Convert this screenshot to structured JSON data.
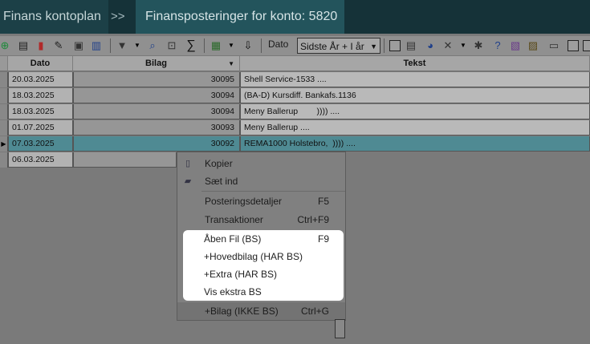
{
  "tabs": {
    "first": "Finans kontoplan",
    "separator": ">>",
    "active": "Finansposteringer for konto: 5820"
  },
  "toolbar": {
    "dato_label": "Dato",
    "period_select": "Sidste År + I år",
    "sigma": "∑"
  },
  "grid": {
    "headers": {
      "dato": "Dato",
      "bilag": "Bilag",
      "tekst": "Tekst"
    },
    "rows": [
      {
        "dato": "20.03.2025",
        "bilag": "30095",
        "tekst": "Shell Service-1533 ...."
      },
      {
        "dato": "18.03.2025",
        "bilag": "30094",
        "tekst": "(BA-D) Kursdiff. Bankafs.1136"
      },
      {
        "dato": "18.03.2025",
        "bilag": "30094",
        "tekst": "Meny Ballerup        )))) ...."
      },
      {
        "dato": "01.07.2025",
        "bilag": "30093",
        "tekst": "Meny Ballerup ...."
      },
      {
        "dato": "07.03.2025",
        "bilag": "30092",
        "tekst": "REMA1000 Holstebro,  )))) ...."
      },
      {
        "dato": "06.03.2025",
        "bilag": "",
        "tekst": ""
      }
    ]
  },
  "context_menu": {
    "copy": "Kopier",
    "paste": "Sæt ind",
    "details": {
      "label": "Posteringsdetaljer",
      "shortcut": "F5"
    },
    "transactions": {
      "label": "Transaktioner",
      "shortcut": "Ctrl+F9"
    },
    "open_file": {
      "label": "Åben Fil (BS)",
      "shortcut": "F9"
    },
    "main_bilag": {
      "label": "+Hovedbilag (HAR BS)"
    },
    "extra": {
      "label": "+Extra (HAR BS)"
    },
    "show_extra": {
      "label": "Vis ekstra BS"
    },
    "add_bilag": {
      "label": "+Bilag (IKKE BS)",
      "shortcut": "Ctrl+G"
    }
  }
}
